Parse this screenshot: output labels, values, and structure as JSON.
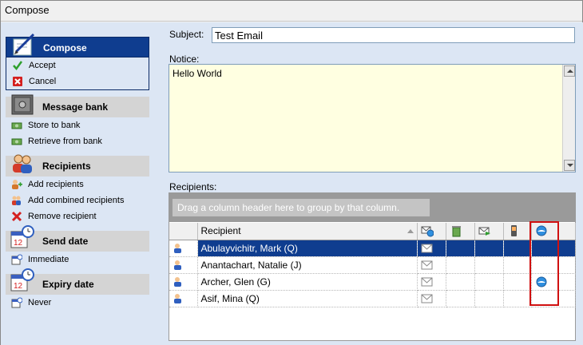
{
  "window": {
    "title": "Compose"
  },
  "sidebar": {
    "groups": [
      {
        "title": "Compose",
        "active": true,
        "icon": "compose-pen-icon",
        "items": [
          {
            "label": "Accept",
            "icon": "checkmark-icon"
          },
          {
            "label": "Cancel",
            "icon": "cancel-x-icon"
          }
        ]
      },
      {
        "title": "Message bank",
        "active": false,
        "icon": "safe-icon",
        "items": [
          {
            "label": "Store to bank",
            "icon": "money-stack-icon"
          },
          {
            "label": "Retrieve from bank",
            "icon": "money-stack-icon"
          }
        ]
      },
      {
        "title": "Recipients",
        "active": false,
        "icon": "users-icon",
        "items": [
          {
            "label": "Add recipients",
            "icon": "add-user-icon"
          },
          {
            "label": "Add combined recipients",
            "icon": "add-users-icon"
          },
          {
            "label": "Remove recipient",
            "icon": "remove-user-icon"
          }
        ]
      },
      {
        "title": "Send date",
        "active": false,
        "icon": "calendar-clock-icon",
        "items": [
          {
            "label": "Immediate",
            "icon": "calendar-small-icon"
          }
        ]
      },
      {
        "title": "Expiry date",
        "active": false,
        "icon": "calendar-clock-icon",
        "items": [
          {
            "label": "Never",
            "icon": "calendar-small-icon"
          }
        ]
      }
    ]
  },
  "form": {
    "subject_label": "Subject:",
    "subject_value": "Test Email",
    "notice_label": "Notice:",
    "notice_value": "Hello World",
    "recipients_label": "Recipients:"
  },
  "grid": {
    "group_hint": "Drag a column header here to group by that column.",
    "columns": [
      {
        "label": "",
        "icon": ""
      },
      {
        "label": "Recipient",
        "icon": ""
      },
      {
        "label": "",
        "icon": "email-globe-icon"
      },
      {
        "label": "",
        "icon": "recycle-bin-icon"
      },
      {
        "label": "",
        "icon": "email-arrow-icon"
      },
      {
        "label": "",
        "icon": "mobile-phone-icon"
      },
      {
        "label": "",
        "icon": "globe-chat-icon"
      }
    ],
    "rows": [
      {
        "name": "Abulayvichitr, Mark (Q)",
        "selected": true,
        "email": true,
        "chat": false
      },
      {
        "name": "Anantachart, Natalie (J)",
        "selected": false,
        "email": true,
        "chat": false
      },
      {
        "name": "Archer, Glen (G)",
        "selected": false,
        "email": true,
        "chat": true
      },
      {
        "name": "Asif, Mina (Q)",
        "selected": false,
        "email": true,
        "chat": false
      }
    ]
  },
  "colors": {
    "selection": "#0f3d8f",
    "highlight": "#d01010",
    "notice_bg": "#ffffe1",
    "sidebar_bg": "#dce6f4"
  }
}
